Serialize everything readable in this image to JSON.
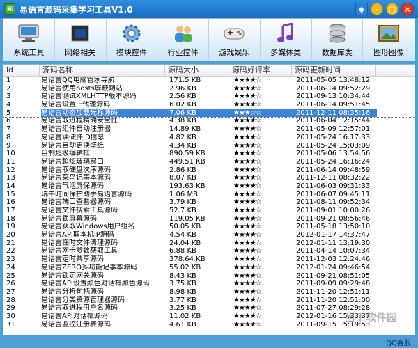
{
  "window": {
    "title": "易语言源码采集学习工具V1.0"
  },
  "titlebar_buttons": {
    "min": "–",
    "max": "□",
    "close": "×"
  },
  "toolbar": [
    {
      "label": "系统工具",
      "icon": "monitor-icon"
    },
    {
      "label": "网络相关",
      "icon": "chip-icon"
    },
    {
      "label": "模块控件",
      "icon": "gear-icon"
    },
    {
      "label": "行业控件",
      "icon": "people-icon"
    },
    {
      "label": "游戏娱乐",
      "icon": "gamepad-icon"
    },
    {
      "label": "多媒体类",
      "icon": "music-note-icon"
    },
    {
      "label": "数据库类",
      "icon": "database-icon"
    },
    {
      "label": "图形图像",
      "icon": "picture-icon"
    }
  ],
  "columns": {
    "id": "id",
    "name": "源码名称",
    "size": "源码大小",
    "rate": "源码好评率",
    "date": "源码更新时间"
  },
  "rows": [
    {
      "id": "1",
      "name": "易语言QQ电脑管家导航",
      "size": "171.5 KB",
      "rate": "★★★★☆",
      "date": "2011-05-05 13:48:12"
    },
    {
      "id": "2",
      "name": "易语言使用hosts屏蔽网站",
      "size": "2.96 KB",
      "rate": "★★★★☆",
      "date": "2011-06-14 09:52:29"
    },
    {
      "id": "3",
      "name": "易语言测试XMLHTTP版本源码",
      "size": "2.56 KB",
      "rate": "★★★★☆",
      "date": "2011-09-13 10:34:44"
    },
    {
      "id": "4",
      "name": "易语言设置IE代理源码",
      "size": "6.02 KB",
      "rate": "★★★★☆",
      "date": "2011-06-14 09:51:45"
    },
    {
      "id": "5",
      "name": "易语言动态加载光标源码",
      "size": "7.06 KB",
      "rate": "★★★☆☆",
      "date": "2011-12-11 08:35:16",
      "selected": true
    },
    {
      "id": "6",
      "name": "易语言取进程精确安全性",
      "size": "4.38 KB",
      "rate": "★★★★☆",
      "date": "2011-06-04 12:15:44"
    },
    {
      "id": "7",
      "name": "易语言组件自动注册器",
      "size": "14.89 KB",
      "rate": "★★★★☆",
      "date": "2011-05-09 12:57:01"
    },
    {
      "id": "8",
      "name": "易语言读硬件ID信息",
      "size": "4.82 KB",
      "rate": "★★★★☆",
      "date": "2011-05-24 16:17:33"
    },
    {
      "id": "9",
      "name": "易语言自动更换壁纸",
      "size": "4.34 KB",
      "rate": "★★★★☆",
      "date": "2011-05-24 15:03:09"
    },
    {
      "id": "10",
      "name": "自制超级编辑框",
      "size": "890.59 KB",
      "rate": "★★★★☆",
      "date": "2011-05-06 13:54:56"
    },
    {
      "id": "11",
      "name": "易语言超炫玻璃窗口",
      "size": "449.51 KB",
      "rate": "★★★★☆",
      "date": "2011-05-24 16:16:24"
    },
    {
      "id": "12",
      "name": "易语言取硬盘次序源码",
      "size": "2.86 KB",
      "rate": "★★★★☆",
      "date": "2011-06-14 09:48:59"
    },
    {
      "id": "13",
      "name": "易语言菜鸟记事本源码",
      "size": "8.07 KB",
      "rate": "★★★★☆",
      "date": "2011-12-11 08:32:22"
    },
    {
      "id": "14",
      "name": "易语言气泡屏保源码",
      "size": "193.63 KB",
      "rate": "★★★★☆",
      "date": "2011-06-03 09:31:33"
    },
    {
      "id": "15",
      "name": "瑞牛时间保护助手易语言源码",
      "size": "1.06 MB",
      "rate": "★★★★☆",
      "date": "2011-06-07 09:45:11"
    },
    {
      "id": "16",
      "name": "易语言端口查看器源码",
      "size": "3.79 KB",
      "rate": "★★★★☆",
      "date": "2011-08-11 09:52:34"
    },
    {
      "id": "17",
      "name": "易语言文件搜索工具源码",
      "size": "52.7 KB",
      "rate": "★★★★☆",
      "date": "2011-09-01 10:00:26"
    },
    {
      "id": "18",
      "name": "易语言锁屏幕源码",
      "size": "119.05 KB",
      "rate": "★★★★☆",
      "date": "2011-09-21 08:56:46"
    },
    {
      "id": "19",
      "name": "易语言获取Windows用户组名",
      "size": "50.05 KB",
      "rate": "★★★★☆",
      "date": "2011-05-18 13:50:10"
    },
    {
      "id": "20",
      "name": "易语言API取本机IP源码",
      "size": "4.54 KB",
      "rate": "★★★★☆",
      "date": "2012-01-17 14:37:47"
    },
    {
      "id": "21",
      "name": "易语言临时文件清理源码",
      "size": "24.04 KB",
      "rate": "★★★★☆",
      "date": "2012-01-11 13:19:30"
    },
    {
      "id": "22",
      "name": "易语言网卡参数获取工具",
      "size": "6.88 KB",
      "rate": "★★★★☆",
      "date": "2011-04-14 10:07:34"
    },
    {
      "id": "23",
      "name": "易语言定时共享源码",
      "size": "378.64 KB",
      "rate": "★★★★☆",
      "date": "2011-12-03 12:24:46"
    },
    {
      "id": "24",
      "name": "易语言ZERO多功能记事本源码",
      "size": "55.02 KB",
      "rate": "★★★★☆",
      "date": "2012-01-24 09:46:54"
    },
    {
      "id": "25",
      "name": "易语言锁定网关源码",
      "size": "8.43 KB",
      "rate": "★★★★☆",
      "date": "2011-09-21 08:51:05"
    },
    {
      "id": "26",
      "name": "易语言API设置颜色对话框颜色源码",
      "size": "3.75 KB",
      "rate": "★★★★☆",
      "date": "2011-09-09 09:29:48"
    },
    {
      "id": "27",
      "name": "易语言分析句柄源码",
      "size": "8.98 KB",
      "rate": "★★★★☆",
      "date": "2011-11-20 12:51:11"
    },
    {
      "id": "28",
      "name": "易语言分类资源管理器源码",
      "size": "3.77 KB",
      "rate": "★★★★☆",
      "date": "2011-11-20 12:51:00"
    },
    {
      "id": "29",
      "name": "易语言取进程用户名源码",
      "size": "3.25 KB",
      "rate": "★★★★☆",
      "date": "2011-07-27 08:29:28"
    },
    {
      "id": "30",
      "name": "易语言API对话框源码",
      "size": "11.02 KB",
      "rate": "★★★★☆",
      "date": "2012-01-16 15:33:37"
    },
    {
      "id": "31",
      "name": "易语言监控注册表源码",
      "size": "4.61 KB",
      "rate": "★★★★☆",
      "date": "2011-09-15 15:19:53"
    }
  ],
  "status": {
    "link": "QQ客服"
  },
  "watermark": "当下软件园",
  "colors": {
    "accent": "#3b83d8",
    "titlebar": "#1a6cc0",
    "frame": "#4f9fd6"
  }
}
